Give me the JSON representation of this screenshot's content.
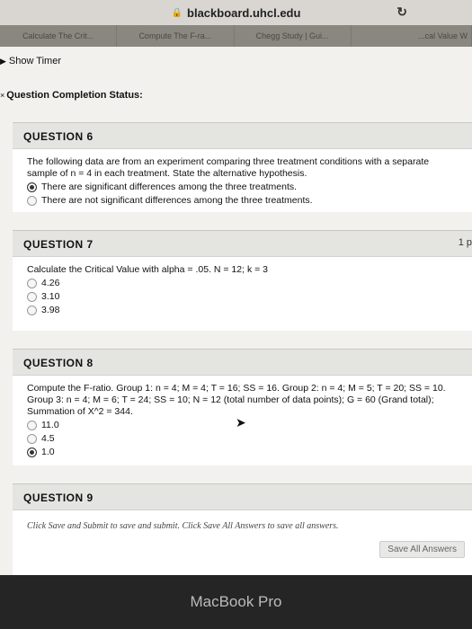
{
  "browser": {
    "url": "blackboard.uhcl.edu",
    "tabs": [
      "Calculate The Crit...",
      "Compute The F-ra...",
      "Chegg Study | Gui...",
      "...cal Value W"
    ]
  },
  "page": {
    "show_timer": "Show Timer",
    "completion_status": "Question Completion Status:",
    "points_partial": "1 p"
  },
  "questions": [
    {
      "title": "QUESTION 6",
      "text": "The following data are from an experiment comparing three treatment conditions with a separate sample of n = 4 in each treatment. State the alternative hypothesis.",
      "options": [
        {
          "label": "There are significant differences among the three treatments.",
          "selected": true
        },
        {
          "label": "There are not significant differences among the three treatments.",
          "selected": false
        }
      ]
    },
    {
      "title": "QUESTION 7",
      "text": "Calculate the Critical Value with alpha = .05. N = 12; k = 3",
      "options": [
        {
          "label": "4.26",
          "selected": false
        },
        {
          "label": "3.10",
          "selected": false
        },
        {
          "label": "3.98",
          "selected": false
        }
      ]
    },
    {
      "title": "QUESTION 8",
      "text": "Compute the F-ratio. Group 1: n = 4; M = 4; T = 16; SS = 16. Group 2: n = 4; M = 5; T = 20; SS = 10. Group 3: n = 4; M = 6; T = 24; SS = 10; N = 12 (total number of data points); G = 60 (Grand total); Summation of X^2 = 344.",
      "options": [
        {
          "label": "11.0",
          "selected": false
        },
        {
          "label": "4.5",
          "selected": false
        },
        {
          "label": "1.0",
          "selected": true
        }
      ]
    },
    {
      "title": "QUESTION 9",
      "text": "Click Save and Submit to save and submit. Click Save All Answers to save all answers.",
      "button": "Save All Answers"
    }
  ],
  "device": {
    "label": "MacBook Pro"
  }
}
